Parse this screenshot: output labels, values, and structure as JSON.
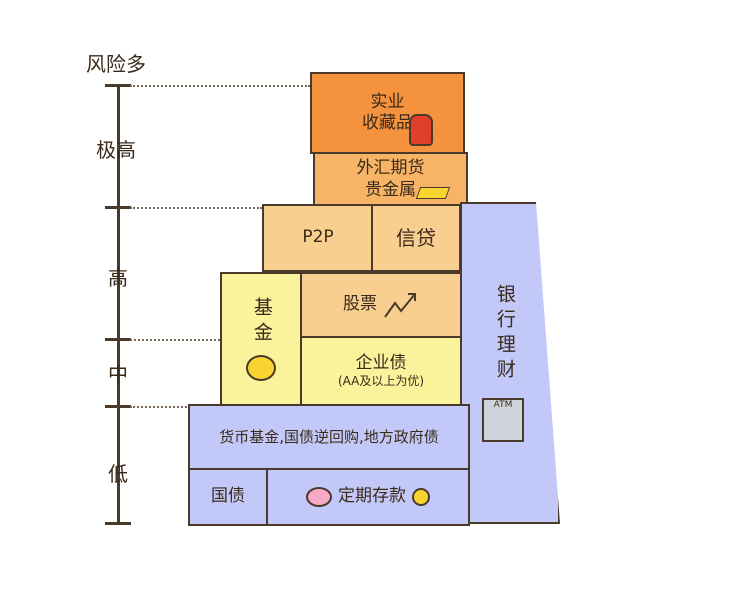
{
  "axis": {
    "title": "风险多",
    "levels": [
      "极高",
      "高",
      "中",
      "低"
    ]
  },
  "blocks": {
    "industry": "实业\n收藏品",
    "forex": "外汇期货\n贵金属",
    "p2p": "P2P",
    "credit": "信贷",
    "fund": "基金",
    "stocks": "股票",
    "corp_bond": "企业债",
    "corp_bond_note": "(AA及以上为优)",
    "money_fund": "货币基金,国债逆回购,地方政府债",
    "treasury": "国债",
    "deposit": "定期存款",
    "bank_wealth": "银行理财",
    "atm_label": "ATM"
  }
}
